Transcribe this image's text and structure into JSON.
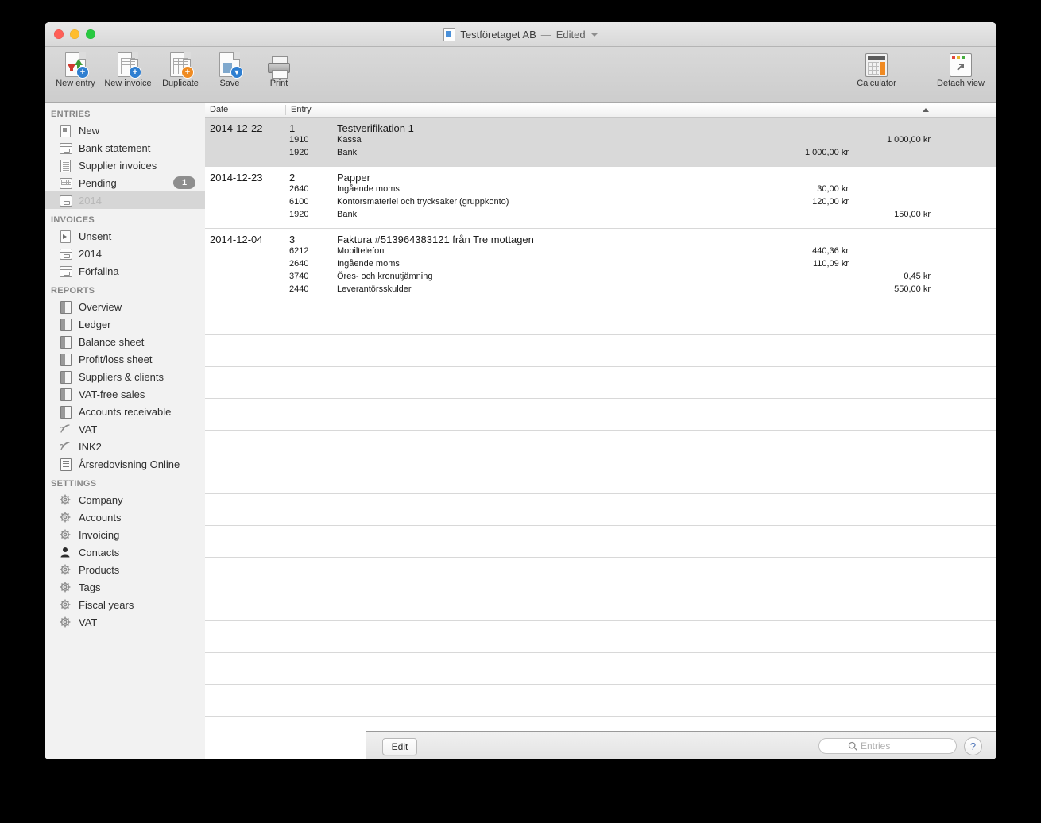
{
  "window": {
    "title": "Testföretaget AB",
    "dash": "—",
    "edited": "Edited",
    "doc_icon": "document-icon",
    "chevron": "chevron-down-icon"
  },
  "toolbar": {
    "left_items": [
      {
        "label": "New entry",
        "icon": "new-entry-icon"
      },
      {
        "label": "New invoice",
        "icon": "new-invoice-icon"
      },
      {
        "label": "Duplicate",
        "icon": "duplicate-icon"
      },
      {
        "label": "Save",
        "icon": "save-icon"
      },
      {
        "label": "Print",
        "icon": "print-icon"
      }
    ],
    "right_items": [
      {
        "label": "Calculator",
        "icon": "calculator-icon"
      },
      {
        "label": "Detach view",
        "icon": "detach-view-icon"
      }
    ]
  },
  "sidebar": {
    "sections": [
      {
        "title": "ENTRIES",
        "items": [
          {
            "label": "New",
            "icon": "new-document-icon",
            "selected": false
          },
          {
            "label": "Bank statement",
            "icon": "archive-box-icon",
            "selected": false
          },
          {
            "label": "Supplier invoices",
            "icon": "invoice-tray-icon",
            "selected": false
          },
          {
            "label": "Pending",
            "icon": "pending-tray-icon",
            "selected": false,
            "badge": "1"
          },
          {
            "label": "2014",
            "icon": "archive-box-icon",
            "selected": true
          }
        ]
      },
      {
        "title": "INVOICES",
        "items": [
          {
            "label": "Unsent",
            "icon": "send-document-icon",
            "selected": false
          },
          {
            "label": "2014",
            "icon": "archive-box-icon",
            "selected": false
          },
          {
            "label": "Förfallna",
            "icon": "overdue-box-icon",
            "selected": false
          }
        ]
      },
      {
        "title": "REPORTS",
        "items": [
          {
            "label": "Overview",
            "icon": "report-book-icon",
            "selected": false
          },
          {
            "label": "Ledger",
            "icon": "report-book-icon",
            "selected": false
          },
          {
            "label": "Balance sheet",
            "icon": "report-book-icon",
            "selected": false
          },
          {
            "label": "Profit/loss sheet",
            "icon": "report-book-icon",
            "selected": false
          },
          {
            "label": "Suppliers & clients",
            "icon": "report-book-icon",
            "selected": false
          },
          {
            "label": "VAT-free sales",
            "icon": "report-book-icon",
            "selected": false
          },
          {
            "label": "Accounts receivable",
            "icon": "report-book-icon",
            "selected": false
          },
          {
            "label": "VAT",
            "icon": "tax-swirl-icon",
            "selected": false
          },
          {
            "label": "INK2",
            "icon": "tax-swirl-icon",
            "selected": false
          },
          {
            "label": "Årsredovisning Online",
            "icon": "annual-report-icon",
            "selected": false
          }
        ]
      },
      {
        "title": "SETTINGS",
        "items": [
          {
            "label": "Company",
            "icon": "gear-icon",
            "selected": false
          },
          {
            "label": "Accounts",
            "icon": "gear-icon",
            "selected": false
          },
          {
            "label": "Invoicing",
            "icon": "gear-icon",
            "selected": false
          },
          {
            "label": "Contacts",
            "icon": "person-icon",
            "selected": false
          },
          {
            "label": "Products",
            "icon": "gear-icon",
            "selected": false
          },
          {
            "label": "Tags",
            "icon": "gear-icon",
            "selected": false
          },
          {
            "label": "Fiscal years",
            "icon": "gear-icon",
            "selected": false
          },
          {
            "label": "VAT",
            "icon": "gear-icon",
            "selected": false
          }
        ]
      }
    ]
  },
  "table": {
    "columns": [
      {
        "label": "Date",
        "key": "date"
      },
      {
        "label": "Entry",
        "key": "entry"
      }
    ],
    "sort_indicator": "sort-ascending-icon",
    "entries": [
      {
        "selected": true,
        "date": "2014-12-22",
        "number": "1",
        "description": "Testverifikation 1",
        "lines": [
          {
            "account": "1910",
            "name": "Kassa",
            "debit": "1 000,00 kr",
            "credit": ""
          },
          {
            "account": "1920",
            "name": "Bank",
            "debit": "",
            "credit": "1 000,00 kr"
          }
        ]
      },
      {
        "selected": false,
        "date": "2014-12-23",
        "number": "2",
        "description": "Papper",
        "lines": [
          {
            "account": "2640",
            "name": "Ingående moms",
            "debit": "",
            "credit": "30,00 kr"
          },
          {
            "account": "6100",
            "name": "Kontorsmateriel och trycksaker (gruppkonto)",
            "debit": "",
            "credit": "120,00 kr"
          },
          {
            "account": "1920",
            "name": "Bank",
            "debit": "150,00 kr",
            "credit": ""
          }
        ]
      },
      {
        "selected": false,
        "date": "2014-12-04",
        "number": "3",
        "description": "Faktura #513964383121 från Tre mottagen",
        "lines": [
          {
            "account": "6212",
            "name": "Mobiltelefon",
            "debit": "",
            "credit": "440,36 kr"
          },
          {
            "account": "2640",
            "name": "Ingående moms",
            "debit": "",
            "credit": "110,09 kr"
          },
          {
            "account": "3740",
            "name": "Öres- och kronutjämning",
            "debit": "0,45 kr",
            "credit": ""
          },
          {
            "account": "2440",
            "name": "Leverantörsskulder",
            "debit": "550,00 kr",
            "credit": ""
          }
        ]
      }
    ],
    "empty_row_count": 15
  },
  "bottombar": {
    "edit_label": "Edit",
    "search_placeholder": "Entries",
    "search_value": "",
    "search_icon": "search-icon",
    "help_label": "?"
  },
  "colors": {
    "selection": "#d9d9d9",
    "sidebar_bg": "#f2f2f2",
    "accent_blue": "#2f7fd1",
    "accent_orange": "#ef8b22"
  }
}
